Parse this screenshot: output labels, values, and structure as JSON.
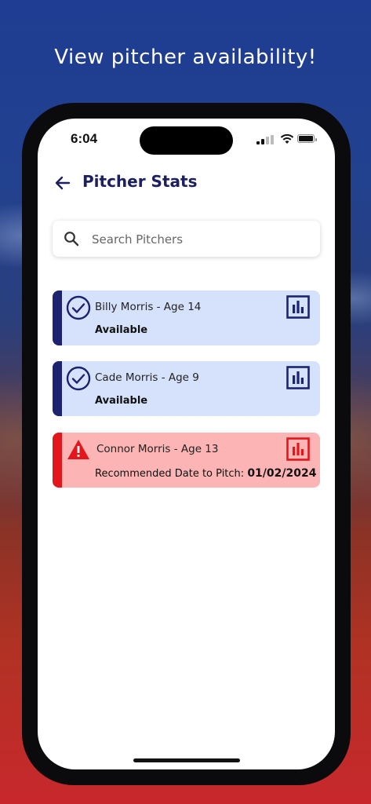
{
  "headline": "View pitcher availability!",
  "status_bar": {
    "time": "6:04"
  },
  "header": {
    "title": "Pitcher Stats"
  },
  "search": {
    "placeholder": "Search Pitchers"
  },
  "pitchers": [
    {
      "name": "Billy Morris - Age 14",
      "status": "Available",
      "state": "available"
    },
    {
      "name": "Cade Morris - Age 9",
      "status": "Available",
      "state": "available"
    },
    {
      "name": "Connor Morris - Age 13",
      "status_label": "Recommended Date to Pitch:",
      "date": "01/02/2024",
      "state": "unavailable"
    }
  ],
  "colors": {
    "navy": "#1d2370",
    "available_bg": "#d6e2fb",
    "warning_red": "#e3161c",
    "warning_bg": "#fcb4b4"
  },
  "icons": {
    "back": "arrow-left-icon",
    "search": "search-icon",
    "available": "check-circle-icon",
    "warning": "warning-triangle-icon",
    "stats": "bar-chart-icon"
  }
}
